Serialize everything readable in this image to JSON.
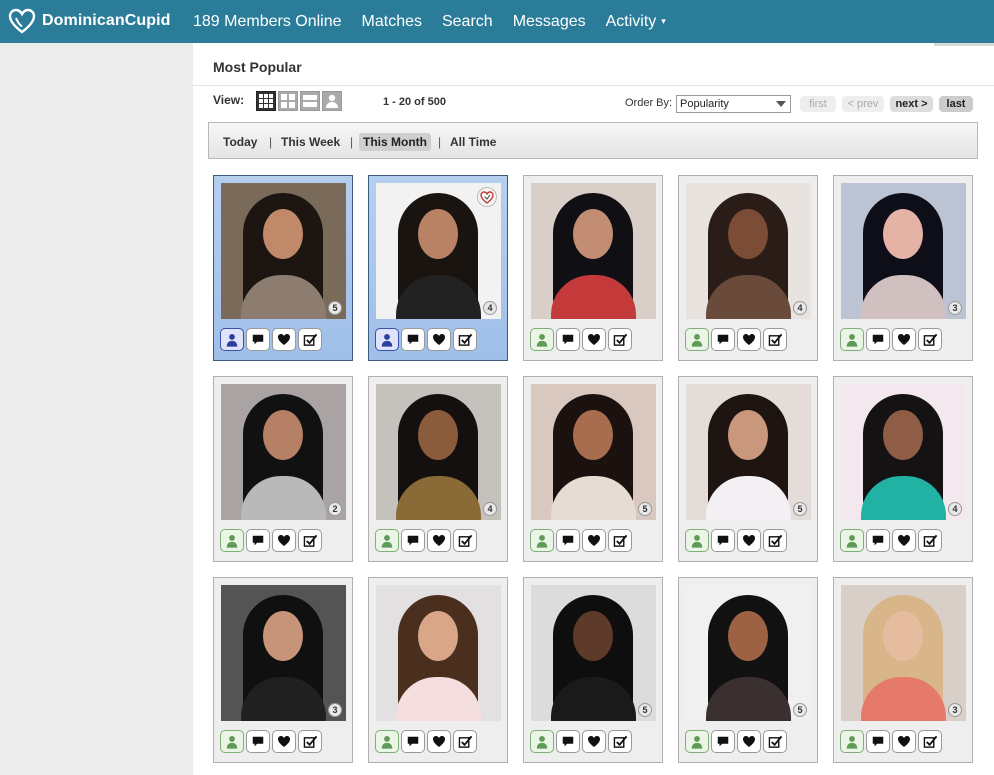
{
  "header": {
    "logo_text": "DominicanCupid",
    "nav": [
      {
        "id": "members-online",
        "label": "189 Members Online"
      },
      {
        "id": "matches",
        "label": "Matches"
      },
      {
        "id": "search",
        "label": "Search"
      },
      {
        "id": "messages",
        "label": "Messages"
      },
      {
        "id": "activity",
        "label": "Activity"
      }
    ],
    "activity_caret": "▾"
  },
  "page": {
    "title": "Most Popular",
    "view_label": "View:",
    "range_text": "1 - 20 of 500",
    "order_label": "Order By:",
    "order_value": "Popularity",
    "pager": {
      "first": "first",
      "prev": "< prev",
      "next": "next >",
      "last": "last"
    }
  },
  "filters": {
    "items": [
      "Today",
      "This Week",
      "This Month",
      "All Time"
    ],
    "separator": "|",
    "active": "This Month"
  },
  "colors": {
    "brand": "#2b7c99",
    "highlight_card": "#b5cfef",
    "online_icon": "#5f9a56",
    "viewed_icon": "#2f3f9e"
  },
  "profiles": [
    {
      "count": "5",
      "highlight": true,
      "fav": false,
      "bg": "#7a6a5a",
      "hair": "#1c1512",
      "skin": "#c08a6a",
      "top": "#8c7d70"
    },
    {
      "count": "4",
      "highlight": true,
      "fav": true,
      "bg": "#f2f2f2",
      "hair": "#1a1411",
      "skin": "#b98264",
      "top": "#222222"
    },
    {
      "count": "",
      "highlight": false,
      "fav": false,
      "bg": "#d9cfc8",
      "hair": "#101014",
      "skin": "#c28d72",
      "top": "#c43a3a"
    },
    {
      "count": "4",
      "highlight": false,
      "fav": false,
      "bg": "#e8e3df",
      "hair": "#2a1c16",
      "skin": "#7b4d36",
      "top": "#6a4a3a"
    },
    {
      "count": "3",
      "highlight": false,
      "fav": false,
      "bg": "#bcc4d4",
      "hair": "#0e0e18",
      "skin": "#e4b3a6",
      "top": "#d0c0c0"
    },
    {
      "count": "2",
      "highlight": false,
      "fav": false,
      "bg": "#a9a3a3",
      "hair": "#111111",
      "skin": "#b58066",
      "top": "#b9b9b9"
    },
    {
      "count": "4",
      "highlight": false,
      "fav": false,
      "bg": "#c5c1bd",
      "hair": "#141010",
      "skin": "#8a5c3c",
      "top": "#8a6a36"
    },
    {
      "count": "5",
      "highlight": false,
      "fav": false,
      "bg": "#d8c8c0",
      "hair": "#1b1210",
      "skin": "#a86c4e",
      "top": "#e6dcd4"
    },
    {
      "count": "5",
      "highlight": false,
      "fav": false,
      "bg": "#e3dcd8",
      "hair": "#1e1412",
      "skin": "#c9977c",
      "top": "#f2f0f2"
    },
    {
      "count": "4",
      "highlight": false,
      "fav": false,
      "bg": "#f2e8ee",
      "hair": "#151214",
      "skin": "#8f5c46",
      "top": "#22b2a4"
    },
    {
      "count": "3",
      "highlight": false,
      "fav": false,
      "bg": "#545454",
      "hair": "#101010",
      "skin": "#c79479",
      "top": "#202020"
    },
    {
      "count": "",
      "highlight": false,
      "fav": false,
      "bg": "#e2e0e0",
      "hair": "#4a2e1e",
      "skin": "#d9a688",
      "top": "#f4dede"
    },
    {
      "count": "5",
      "highlight": false,
      "fav": false,
      "bg": "#dcdcdc",
      "hair": "#0e0e0e",
      "skin": "#5d3a2a",
      "top": "#1a1a1a"
    },
    {
      "count": "5",
      "highlight": false,
      "fav": false,
      "bg": "#f0f0f0",
      "hair": "#111111",
      "skin": "#9d6244",
      "top": "#3a3030"
    },
    {
      "count": "3",
      "highlight": false,
      "fav": false,
      "bg": "#d8cfc8",
      "hair": "#d8b68a",
      "skin": "#e6bca0",
      "top": "#e67a6a"
    }
  ]
}
